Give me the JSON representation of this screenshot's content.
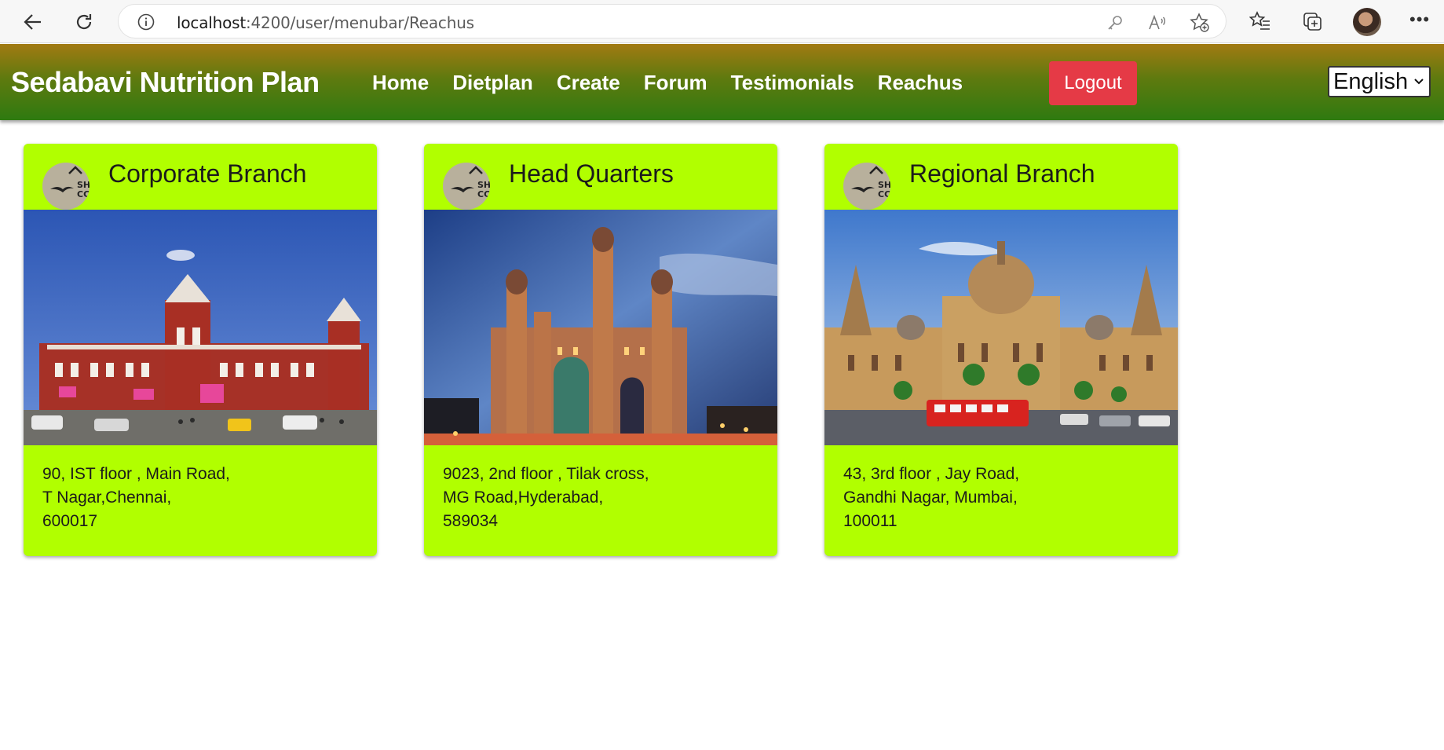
{
  "browser": {
    "url_host": "localhost",
    "url_rest": ":4200/user/menubar/Reachus"
  },
  "header": {
    "brand": "Sedabavi Nutrition Plan",
    "menu": [
      "Home",
      "Dietplan",
      "Create",
      "Forum",
      "Testimonials",
      "Reachus"
    ],
    "logout_label": "Logout",
    "language": "English"
  },
  "cards": [
    {
      "title": "Corporate Branch",
      "address": [
        "90, IST floor , Main Road,",
        "T Nagar,Chennai,",
        "600017"
      ]
    },
    {
      "title": "Head Quarters",
      "address": [
        "9023, 2nd floor , Tilak cross,",
        "MG Road,Hyderabad,",
        "589034"
      ]
    },
    {
      "title": "Regional Branch",
      "address": [
        "43, 3rd floor , Jay Road,",
        "Gandhi Nagar, Mumbai,",
        "100011"
      ]
    }
  ],
  "colors": {
    "card_bg": "#b1ff00",
    "header_top": "#a27a12",
    "header_bottom": "#2e7a10",
    "logout_bg": "#e53a46"
  }
}
